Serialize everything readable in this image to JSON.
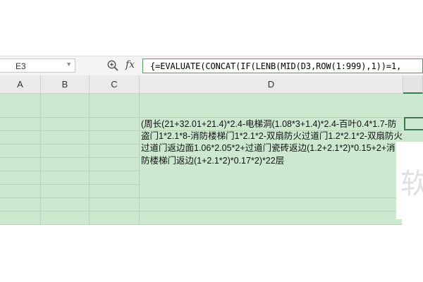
{
  "name_box": {
    "value": "E3"
  },
  "formula_bar": {
    "fx_label": "fx",
    "formula": "{=EVALUATE(CONCAT(IF(LENB(MID(D3,ROW(1:999),1))=1,"
  },
  "columns": [
    "A",
    "B",
    "C",
    "D"
  ],
  "cell_d3": {
    "text": "(周长(21+32.01+21.4)*2.4-电梯洞(1.08*3+1.4)*2.4-百叶0.4*1.7-防盗门1*2.1*8-消防楼梯门1*2.1*2-双扇防火过道门1.2*2.1*2-双扇防火过道门返边面1.06*2.05*2+过道门瓷砖返边(1.2+2.1*2)*0.15+2+消防楼梯门返边(1+2.1*2)*0.17*2)*22层"
  },
  "watermark": {
    "text": "软"
  },
  "colors": {
    "sheet_bg": "#cce8cf",
    "grid": "#b5d4b8",
    "selection": "#3a7d4a",
    "formula_border": "#4d9e62"
  }
}
